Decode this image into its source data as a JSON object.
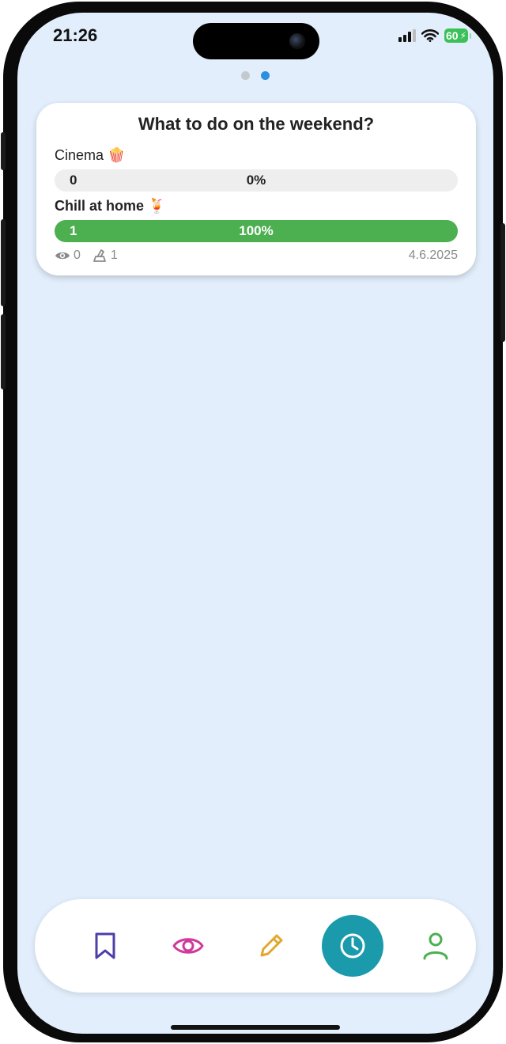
{
  "status_bar": {
    "time": "21:26",
    "battery": "60"
  },
  "pager": {
    "pages": 2,
    "active_index": 1
  },
  "poll": {
    "title": "What to do on the weekend?",
    "options": [
      {
        "label": "Cinema 🍿",
        "count": "0",
        "percent": "0%",
        "fill_fraction": 0,
        "bold": false
      },
      {
        "label": "Chill at home 🍹",
        "count": "1",
        "percent": "100%",
        "fill_fraction": 1,
        "bold": true
      }
    ],
    "views": "0",
    "votes": "1",
    "date": "4.6.2025"
  },
  "colors": {
    "background": "#e2eefb",
    "bar_win": "#4caf50",
    "bar_empty": "#eeeeee",
    "tab_active": "#1a9aab",
    "icon_bookmark": "#4b3fa8",
    "icon_eye": "#d03a9a",
    "icon_pencil": "#e2a72e",
    "icon_person": "#4caf50"
  },
  "tabs": [
    {
      "icon": "bookmark-icon"
    },
    {
      "icon": "eye-icon"
    },
    {
      "icon": "pencil-icon"
    },
    {
      "icon": "clock-icon",
      "active": true
    },
    {
      "icon": "person-icon"
    }
  ]
}
